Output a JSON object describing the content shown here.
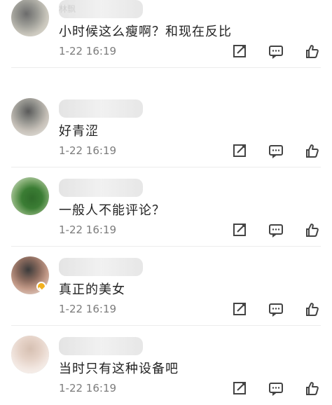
{
  "comments": [
    {
      "username": "林飘",
      "text": "小时候这么瘦啊？和现在反比",
      "time": "1-22 16:19",
      "icons": {
        "share": "edit-share-icon",
        "comment": "comment-icon",
        "like": "thumbs-up-icon"
      }
    },
    {
      "username": "",
      "text": "好青涩",
      "time": "1-22 16:19",
      "icons": {
        "share": "edit-share-icon",
        "comment": "comment-icon",
        "like": "thumbs-up-icon"
      }
    },
    {
      "username": "",
      "text": "一般人不能评论？",
      "time": "1-22 16:19",
      "icons": {
        "share": "edit-share-icon",
        "comment": "comment-icon",
        "like": "thumbs-up-icon"
      }
    },
    {
      "username": "",
      "text": "真正的美女",
      "time": "1-22 16:19",
      "icons": {
        "share": "edit-share-icon",
        "comment": "comment-icon",
        "like": "thumbs-up-icon"
      }
    },
    {
      "username": "",
      "text": "当时只有这种设备吧",
      "time": "1-22 16:19",
      "icons": {
        "share": "edit-share-icon",
        "comment": "comment-icon",
        "like": "thumbs-up-icon"
      }
    }
  ],
  "colors": {
    "text": "#222222",
    "time": "#7c7c7c",
    "icon": "#444444",
    "badge": "#f2b01e",
    "divider": "#ececec"
  }
}
